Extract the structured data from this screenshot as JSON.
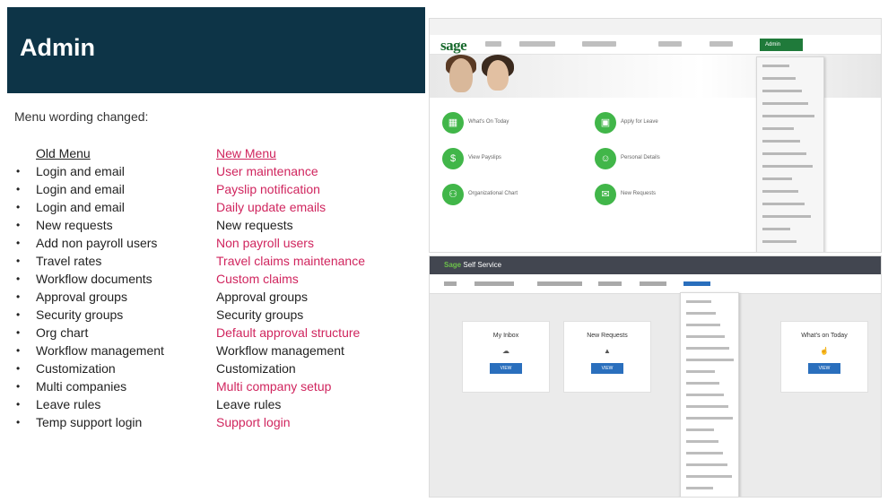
{
  "slide": {
    "title": "Admin",
    "intro": "Menu wording changed:",
    "old_header": "Old Menu",
    "new_header": "New Menu",
    "bullet": "•",
    "rows": [
      {
        "old": "Login and email",
        "new": "User maintenance",
        "changed": true
      },
      {
        "old": "Login and email",
        "new": "Payslip notification",
        "changed": true
      },
      {
        "old": "Login and email",
        "new": "Daily update emails",
        "changed": true
      },
      {
        "old": "New requests",
        "new": "New requests",
        "changed": false
      },
      {
        "old": "Add non payroll users",
        "new": "Non payroll users",
        "changed": true
      },
      {
        "old": "Travel rates",
        "new": "Travel claims maintenance",
        "changed": true
      },
      {
        "old": "Workflow documents",
        "new": "Custom claims",
        "changed": true
      },
      {
        "old": "Approval groups",
        "new": "Approval groups",
        "changed": false
      },
      {
        "old": "Security groups",
        "new": "Security groups",
        "changed": false
      },
      {
        "old": "Org chart",
        "new": "Default approval structure",
        "changed": true
      },
      {
        "old": "Workflow management",
        "new": "Workflow management",
        "changed": false
      },
      {
        "old": "Customization",
        "new": "Customization",
        "changed": false
      },
      {
        "old": "Multi companies",
        "new": "Multi company setup",
        "changed": true
      },
      {
        "old": "Leave rules",
        "new": "Leave rules",
        "changed": false
      },
      {
        "old": "Temp support login",
        "new": "Support login",
        "changed": true
      }
    ]
  },
  "screenshot_old": {
    "logo": "sage",
    "active_menu": "Admin",
    "tiles": [
      {
        "label": "What's On Today",
        "icon": "calendar-icon"
      },
      {
        "label": "Apply for Leave",
        "icon": "leave-icon"
      },
      {
        "label": "View Payslips",
        "icon": "payslip-icon"
      },
      {
        "label": "Personal Details",
        "icon": "person-icon"
      },
      {
        "label": "Organizational Chart",
        "icon": "org-chart-icon"
      },
      {
        "label": "New Requests",
        "icon": "mail-icon"
      }
    ],
    "tile_color": "#41b649"
  },
  "screenshot_new": {
    "brand": "Sage",
    "title": "Self Service",
    "cards": [
      {
        "title": "My Inbox",
        "button": "VIEW"
      },
      {
        "title": "New Requests",
        "button": "VIEW"
      },
      {
        "title": "What's on Today",
        "button": "VIEW"
      }
    ],
    "accent": "#2a6fbd"
  },
  "colors": {
    "title_bg": "#0d3447",
    "changed_text": "#d0255e"
  }
}
